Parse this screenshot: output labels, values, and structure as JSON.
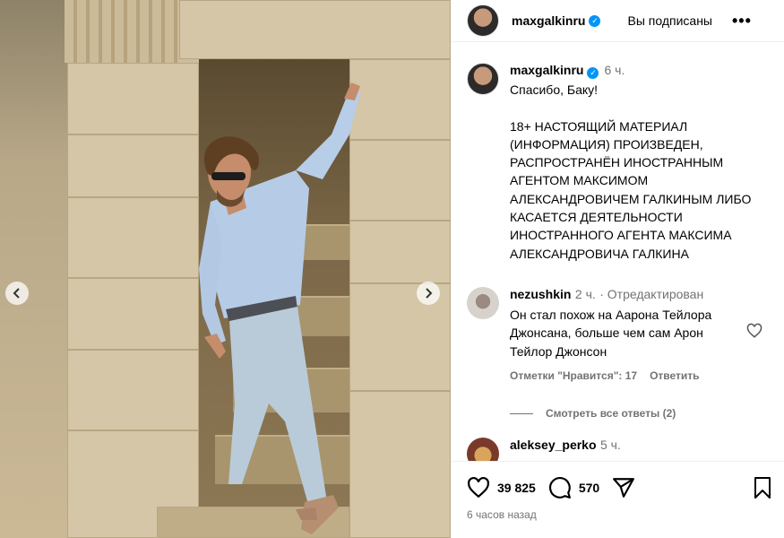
{
  "header": {
    "username": "maxgalkinru",
    "follow_state": "Вы подписаны",
    "more": "•••"
  },
  "caption": {
    "username": "maxgalkinru",
    "time": "6 ч.",
    "text": "Спасибо, Баку!\n\n18+ НАСТОЯЩИЙ МАТЕРИАЛ (ИНФОРМАЦИЯ)  ПРОИЗВЕДЕН, РАСПРОСТРАНЁН ИНОСТРАННЫМ АГЕНТОМ МАКСИМОМ АЛЕКСАНДРОВИЧЕМ ГАЛКИНЫМ ЛИБО КАСАЕТСЯ ДЕЯТЕЛЬНОСТИ ИНОСТРАННОГО АГЕНТА МАКСИМА АЛЕКСАНДРОВИЧА ГАЛКИНА"
  },
  "comments": [
    {
      "username": "nezushkin",
      "time": "2 ч.",
      "edited": "· Отредактирован",
      "text": "Он стал похож на Аарона Тейлора Джонсана, больше чем сам Арон Тейлор Джонсон",
      "likes_label": "Отметки \"Нравится\": 17",
      "reply_label": "Ответить"
    },
    {
      "username": "aleksey_perko",
      "time": "5 ч."
    }
  ],
  "view_replies": "Смотреть все ответы (2)",
  "footer": {
    "likes": "39 825",
    "comments": "570",
    "posted_ago": "6 часов назад"
  },
  "icons": [
    "chevron-left-icon",
    "chevron-right-icon",
    "verified-icon",
    "heart-icon",
    "comment-icon",
    "share-icon",
    "bookmark-icon",
    "more-icon"
  ],
  "colors": {
    "verified": "#0095f6",
    "muted": "#737373"
  }
}
